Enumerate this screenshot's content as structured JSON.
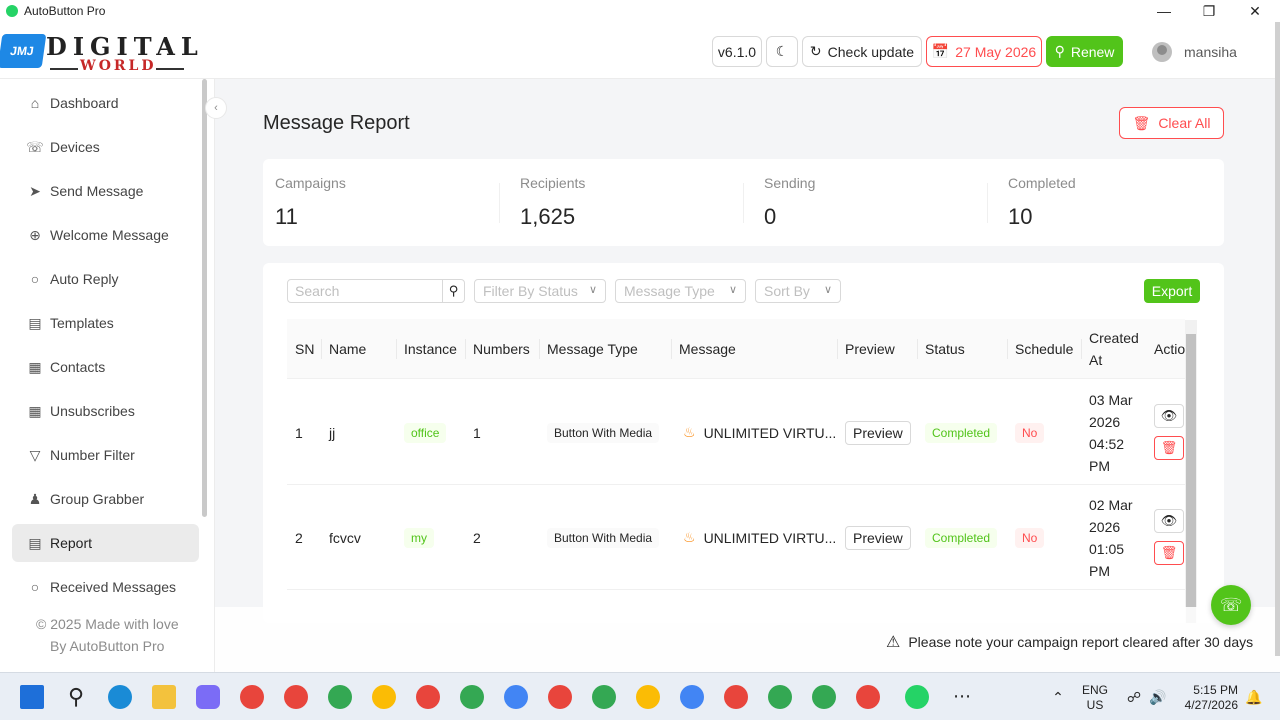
{
  "window": {
    "title": "AutoButton Pro"
  },
  "header": {
    "logo_text": "DIGITAL",
    "logo_sub": "WORLD",
    "logo_badge": "JMJ",
    "version": "v6.1.0",
    "check_update": "Check update",
    "expiry_date": "27 May 2026",
    "renew": "Renew",
    "username": "mansiha"
  },
  "sidebar": {
    "items": [
      {
        "label": "Dashboard",
        "icon": "home-icon"
      },
      {
        "label": "Devices",
        "icon": "whatsapp-icon"
      },
      {
        "label": "Send Message",
        "icon": "send-icon"
      },
      {
        "label": "Welcome Message",
        "icon": "chevron-circle-icon"
      },
      {
        "label": "Auto Reply",
        "icon": "chat-icon"
      },
      {
        "label": "Templates",
        "icon": "document-icon"
      },
      {
        "label": "Contacts",
        "icon": "contacts-icon"
      },
      {
        "label": "Unsubscribes",
        "icon": "contacts-icon"
      },
      {
        "label": "Number Filter",
        "icon": "filter-icon"
      },
      {
        "label": "Group Grabber",
        "icon": "group-icon"
      },
      {
        "label": "Report",
        "icon": "report-icon",
        "active": true
      },
      {
        "label": "Received Messages",
        "icon": "chat-icon"
      }
    ],
    "footer_line1": "© 2025 Made with love",
    "footer_line2": "By AutoButton Pro"
  },
  "main": {
    "title": "Message Report",
    "clear_all": "Clear All",
    "stats": [
      {
        "label": "Campaigns",
        "value": "11"
      },
      {
        "label": "Recipients",
        "value": "1,625"
      },
      {
        "label": "Sending",
        "value": "0"
      },
      {
        "label": "Completed",
        "value": "10"
      }
    ],
    "filters": {
      "search_placeholder": "Search",
      "status_placeholder": "Filter By Status",
      "type_placeholder": "Message Type",
      "sort_placeholder": "Sort By",
      "export": "Export"
    },
    "table": {
      "columns": [
        "SN",
        "Name",
        "Instance",
        "Numbers",
        "Message Type",
        "Message",
        "Preview",
        "Status",
        "Schedule",
        "Created At",
        "Actio"
      ],
      "rows": [
        {
          "sn": "1",
          "name": "jj",
          "instance": "office",
          "numbers": "1",
          "type": "Button With Media",
          "message": "UNLIMITED VIRTU...",
          "preview": "Preview",
          "status": "Completed",
          "schedule": "No",
          "created_date": "03 Mar",
          "created_year": "2026",
          "created_time": "04:52",
          "created_ampm": "PM"
        },
        {
          "sn": "2",
          "name": "fcvcv",
          "instance": "my",
          "numbers": "2",
          "type": "Button With Media",
          "message": "UNLIMITED VIRTU...",
          "preview": "Preview",
          "status": "Completed",
          "schedule": "No",
          "created_date": "02 Mar",
          "created_year": "2026",
          "created_time": "01:05",
          "created_ampm": "PM"
        }
      ]
    },
    "notice": "Please note your campaign report cleared after 30 days"
  },
  "taskbar": {
    "lang": "ENG",
    "region": "US",
    "time": "5:15 PM",
    "date": "4/27/2026"
  },
  "colors": {
    "accent_green": "#52c41a",
    "danger_red": "#ff4d4f"
  }
}
